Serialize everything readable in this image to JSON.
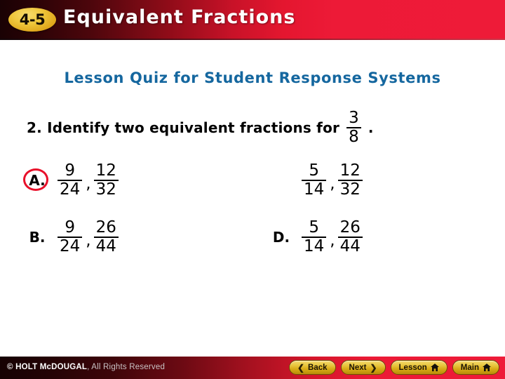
{
  "header": {
    "badge": "4-5",
    "title": "Equivalent Fractions"
  },
  "slide": {
    "subtitle": "Lesson Quiz for Student Response Systems",
    "question": {
      "number_and_text": "2. Identify two equivalent fractions for",
      "fraction": {
        "numerator": "3",
        "denominator": "8"
      },
      "trailing_punctuation": "."
    },
    "choices": [
      {
        "label": "A.",
        "selected": true,
        "pair": [
          {
            "numerator": "9",
            "denominator": "24"
          },
          {
            "numerator": "12",
            "denominator": "32"
          }
        ],
        "separator": ","
      },
      {
        "label": "B.",
        "selected": false,
        "pair": [
          {
            "numerator": "9",
            "denominator": "24"
          },
          {
            "numerator": "26",
            "denominator": "44"
          }
        ],
        "separator": ","
      },
      {
        "label": "",
        "selected": false,
        "pair": [
          {
            "numerator": "5",
            "denominator": "14"
          },
          {
            "numerator": "12",
            "denominator": "32"
          }
        ],
        "separator": ","
      },
      {
        "label": "D.",
        "selected": false,
        "pair": [
          {
            "numerator": "5",
            "denominator": "14"
          },
          {
            "numerator": "26",
            "denominator": "44"
          }
        ],
        "separator": ","
      }
    ]
  },
  "footer": {
    "copyright_strong": "© HOLT McDOUGAL",
    "copyright_weak": ", All Rights Reserved",
    "nav": [
      {
        "label": "Back",
        "icon": "chevron-left-icon",
        "chevron": "❮"
      },
      {
        "label": "Next",
        "icon": "chevron-right-icon",
        "chevron": "❯"
      },
      {
        "label": "Lesson",
        "icon": "home-icon"
      },
      {
        "label": "Main",
        "icon": "home-icon"
      }
    ]
  },
  "colors": {
    "header_red": "#ed1a37",
    "header_dark": "#1a0204",
    "badge_gold": "#efc73c",
    "subtitle_blue": "#15679f",
    "highlight_red": "#e8102a",
    "nav_gold": "#e9c63f"
  }
}
